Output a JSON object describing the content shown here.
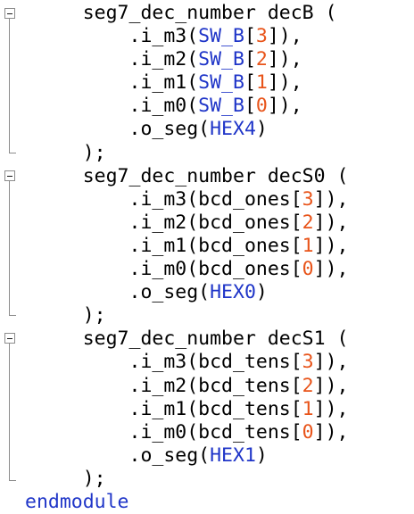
{
  "editor": {
    "colors": {
      "background": "#ffffff",
      "text": "#000000",
      "keyword": "#1f35c8",
      "identifier": "#1f35c8",
      "number": "#e8541a",
      "fold": "#8c8c8c"
    },
    "fold_icon": "fold-minus-icon",
    "lines": [
      [
        {
          "t": "     seg7_dec_number decB ("
        }
      ],
      [
        {
          "t": "         .i_m3("
        },
        {
          "t": "SW_B",
          "c": "id"
        },
        {
          "t": "["
        },
        {
          "t": "3",
          "c": "num"
        },
        {
          "t": "]),"
        }
      ],
      [
        {
          "t": "         .i_m2("
        },
        {
          "t": "SW_B",
          "c": "id"
        },
        {
          "t": "["
        },
        {
          "t": "2",
          "c": "num"
        },
        {
          "t": "]),"
        }
      ],
      [
        {
          "t": "         .i_m1("
        },
        {
          "t": "SW_B",
          "c": "id"
        },
        {
          "t": "["
        },
        {
          "t": "1",
          "c": "num"
        },
        {
          "t": "]),"
        }
      ],
      [
        {
          "t": "         .i_m0("
        },
        {
          "t": "SW_B",
          "c": "id"
        },
        {
          "t": "["
        },
        {
          "t": "0",
          "c": "num"
        },
        {
          "t": "]),"
        }
      ],
      [
        {
          "t": "         .o_seg("
        },
        {
          "t": "HEX4",
          "c": "id"
        },
        {
          "t": ")"
        }
      ],
      [
        {
          "t": "     );"
        }
      ],
      [
        {
          "t": "     seg7_dec_number decS0 ("
        }
      ],
      [
        {
          "t": "         .i_m3(bcd_ones["
        },
        {
          "t": "3",
          "c": "num"
        },
        {
          "t": "]),"
        }
      ],
      [
        {
          "t": "         .i_m2(bcd_ones["
        },
        {
          "t": "2",
          "c": "num"
        },
        {
          "t": "]),"
        }
      ],
      [
        {
          "t": "         .i_m1(bcd_ones["
        },
        {
          "t": "1",
          "c": "num"
        },
        {
          "t": "]),"
        }
      ],
      [
        {
          "t": "         .i_m0(bcd_ones["
        },
        {
          "t": "0",
          "c": "num"
        },
        {
          "t": "]),"
        }
      ],
      [
        {
          "t": "         .o_seg("
        },
        {
          "t": "HEX0",
          "c": "id"
        },
        {
          "t": ")"
        }
      ],
      [
        {
          "t": "     );"
        }
      ],
      [
        {
          "t": "     seg7_dec_number decS1 ("
        }
      ],
      [
        {
          "t": "         .i_m3(bcd_tens["
        },
        {
          "t": "3",
          "c": "num"
        },
        {
          "t": "]),"
        }
      ],
      [
        {
          "t": "         .i_m2(bcd_tens["
        },
        {
          "t": "2",
          "c": "num"
        },
        {
          "t": "]),"
        }
      ],
      [
        {
          "t": "         .i_m1(bcd_tens["
        },
        {
          "t": "1",
          "c": "num"
        },
        {
          "t": "]),"
        }
      ],
      [
        {
          "t": "         .i_m0(bcd_tens["
        },
        {
          "t": "0",
          "c": "num"
        },
        {
          "t": "]),"
        }
      ],
      [
        {
          "t": "         .o_seg("
        },
        {
          "t": "HEX1",
          "c": "id"
        },
        {
          "t": ")"
        }
      ],
      [
        {
          "t": "     );"
        }
      ],
      [
        {
          "t": "endmodule",
          "c": "kw"
        }
      ]
    ]
  }
}
